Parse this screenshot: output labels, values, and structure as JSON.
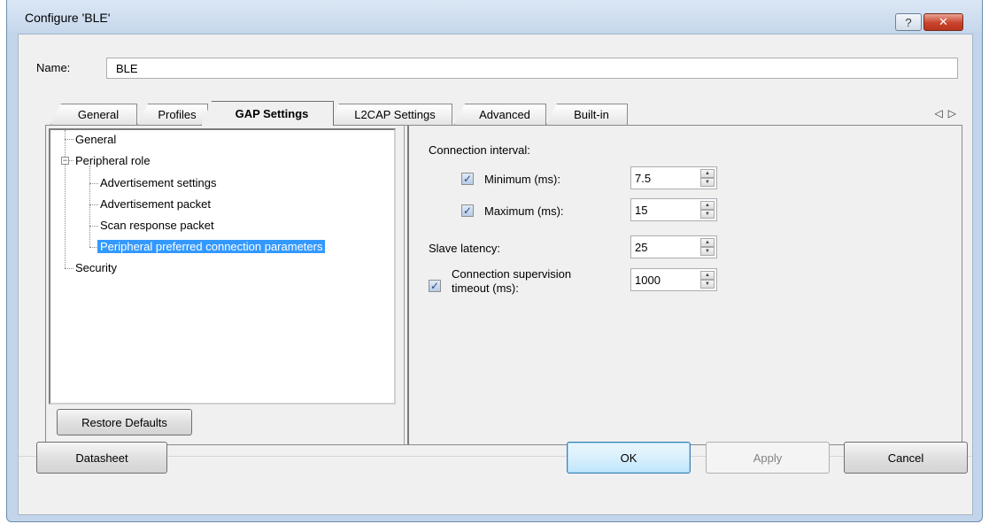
{
  "window": {
    "title": "Configure 'BLE'"
  },
  "titlebar": {
    "help_glyph": "?",
    "close_glyph": "✕"
  },
  "name": {
    "label": "Name:",
    "value": "BLE"
  },
  "tabs": [
    {
      "label": "General"
    },
    {
      "label": "Profiles"
    },
    {
      "label": "GAP Settings",
      "active": true
    },
    {
      "label": "L2CAP Settings"
    },
    {
      "label": "Advanced"
    },
    {
      "label": "Built-in"
    }
  ],
  "tab_scroll": {
    "left": "◁",
    "right": "▷"
  },
  "tree": {
    "items": [
      {
        "label": "General",
        "level": 0
      },
      {
        "label": "Peripheral role",
        "level": 0,
        "expander": "−"
      },
      {
        "label": "Advertisement settings",
        "level": 1
      },
      {
        "label": "Advertisement packet",
        "level": 1
      },
      {
        "label": "Scan response packet",
        "level": 1
      },
      {
        "label": "Peripheral preferred connection parameters",
        "level": 1,
        "selected": true
      },
      {
        "label": "Security",
        "level": 0
      }
    ]
  },
  "restore_defaults_label": "Restore Defaults",
  "params": {
    "connection_interval_label": "Connection interval:",
    "minimum": {
      "label": "Minimum (ms):",
      "value": "7.5",
      "checked": true
    },
    "maximum": {
      "label": "Maximum (ms):",
      "value": "15",
      "checked": true
    },
    "slave_latency": {
      "label": "Slave latency:",
      "value": "25"
    },
    "supervision": {
      "label_line1": "Connection supervision",
      "label_line2": "timeout (ms):",
      "value": "1000",
      "checked": true
    },
    "check_glyph": "✓",
    "spin_up_glyph": "▲",
    "spin_down_glyph": "▼"
  },
  "footer": {
    "datasheet_label": "Datasheet",
    "ok_label": "OK",
    "apply_label": "Apply",
    "cancel_label": "Cancel"
  }
}
